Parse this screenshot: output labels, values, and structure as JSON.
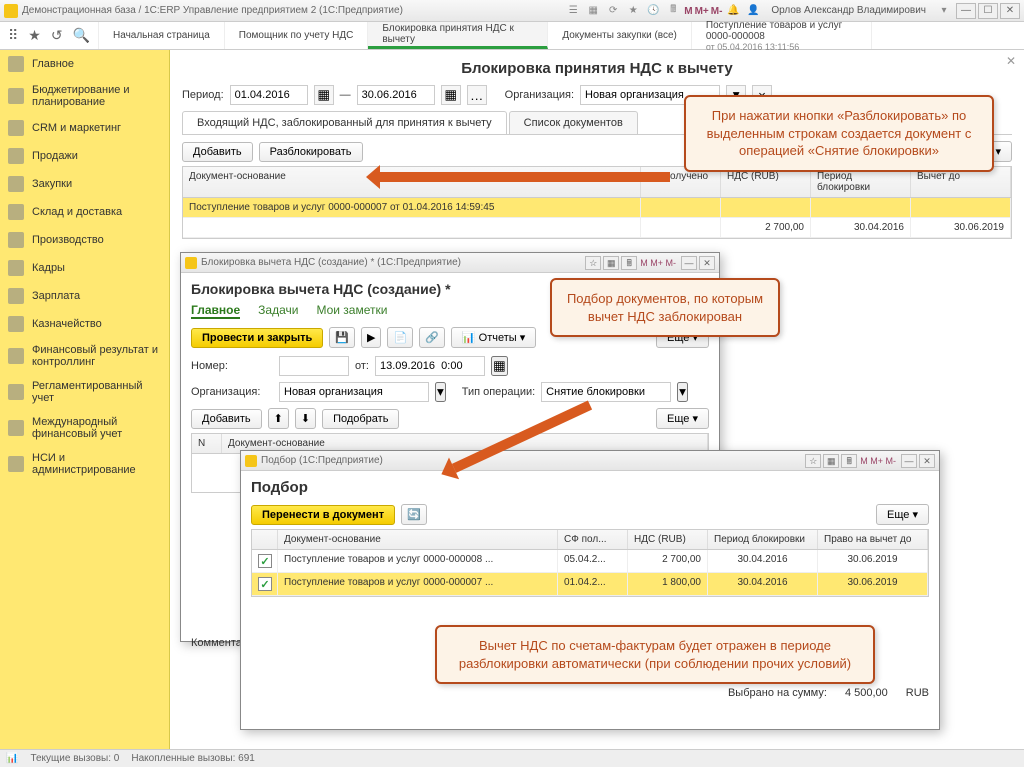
{
  "app": {
    "title": "Демонстрационная база / 1С:ERP Управление предприятием 2  (1С:Предприятие)",
    "user": "Орлов Александр Владимирович",
    "m_plus": "M+",
    "m_minus": "M-",
    "m": "M"
  },
  "top_tabs": [
    {
      "label": "Начальная страница"
    },
    {
      "label": "Помощник по учету НДС"
    },
    {
      "label": "Блокировка принятия НДС к вычету",
      "active": true
    },
    {
      "label": "Документы закупки (все)"
    },
    {
      "label": "Поступление товаров и услуг 0000-000008",
      "sub": "от 05.04.2016 13:11:56"
    }
  ],
  "sidebar": [
    "Главное",
    "Бюджетирование и планирование",
    "CRM и маркетинг",
    "Продажи",
    "Закупки",
    "Склад и доставка",
    "Производство",
    "Кадры",
    "Зарплата",
    "Казначейство",
    "Финансовый результат и контроллинг",
    "Регламентированный учет",
    "Международный финансовый учет",
    "НСИ и администрирование"
  ],
  "page": {
    "title": "Блокировка принятия НДС к вычету",
    "period_label": "Период:",
    "date_from": "01.04.2016",
    "date_to": "30.06.2016",
    "org_label": "Организация:",
    "org_value": "Новая организация",
    "subtabs": [
      "Входящий НДС, заблокированный для принятия к вычету",
      "Список документов"
    ],
    "btn_add": "Добавить",
    "btn_unblock": "Разблокировать",
    "more": "Еще",
    "grid_headers": [
      "Документ-основание",
      "СФ получено",
      "НДС (RUB)",
      "Период блокировки",
      "Вычет до"
    ],
    "grid_rows": [
      {
        "doc": "Поступление товаров и услуг 0000-000007 от 01.04.2016 14:59:45",
        "sel": true
      },
      {
        "doc": "",
        "sf": "",
        "nds": "2 700,00",
        "period": "30.04.2016",
        "until": "30.06.2019"
      }
    ]
  },
  "win1": {
    "title": "Блокировка вычета НДС (создание) *  (1С:Предприятие)",
    "heading": "Блокировка вычета НДС (создание) *",
    "tabs": [
      "Главное",
      "Задачи",
      "Мои заметки"
    ],
    "btn_save": "Провести и закрыть",
    "btn_reports": "Отчеты",
    "num_label": "Номер:",
    "date_label": "от:",
    "date_value": "13.09.2016  0:00",
    "org_label": "Организация:",
    "org_value": "Новая организация",
    "op_label": "Тип операции:",
    "op_value": "Снятие блокировки",
    "btn_add": "Добавить",
    "btn_pick": "Подобрать",
    "more": "Еще",
    "col_n": "N",
    "col_doc": "Документ-основание",
    "comment_label": "Комментар"
  },
  "win2": {
    "title": "Подбор  (1С:Предприятие)",
    "heading": "Подбор",
    "btn_transfer": "Перенести в документ",
    "more": "Еще",
    "headers": [
      "",
      "Документ-основание",
      "СФ пол...",
      "НДС (RUB)",
      "Период блокировки",
      "Право на вычет до"
    ],
    "rows": [
      {
        "chk": true,
        "doc": "Поступление товаров и услуг 0000-000008 ...",
        "sf": "05.04.2...",
        "nds": "2 700,00",
        "period": "30.04.2016",
        "until": "30.06.2019"
      },
      {
        "chk": true,
        "doc": "Поступление товаров и услуг 0000-000007 ...",
        "sf": "01.04.2...",
        "nds": "1 800,00",
        "period": "30.04.2016",
        "until": "30.06.2019",
        "sel": true
      }
    ],
    "footer_label": "Выбрано на сумму:",
    "footer_sum": "4 500,00",
    "footer_cur": "RUB"
  },
  "callouts": {
    "c1": "При нажатии кнопки «Разблокировать» по выделенным строкам создается документ с операцией «Снятие блокировки»",
    "c2": "Подбор документов, по которым вычет НДС заблокирован",
    "c3": "Вычет НДС по счетам-фактурам будет отражен в периоде разблокировки автоматически (при соблюдении прочих условий)"
  },
  "status": {
    "calls": "Текущие вызовы: 0",
    "accum": "Накопленные вызовы: 691"
  }
}
